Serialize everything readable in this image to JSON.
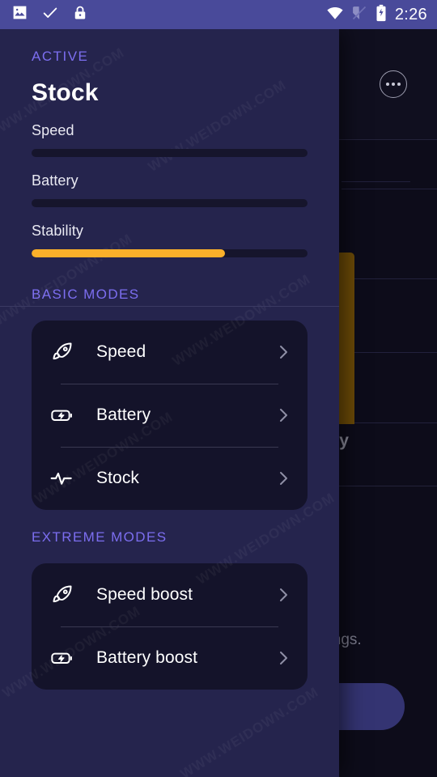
{
  "statusbar": {
    "time": "2:26",
    "left_icons": [
      "image-icon",
      "check-icon",
      "lock-icon"
    ],
    "right_icons": [
      "wifi-icon",
      "no-sim-icon",
      "battery-charging-icon"
    ],
    "background_color": "#494a9a"
  },
  "drawer": {
    "background_color": "#25244d",
    "watermark": "WWW.WEIDOWN.COM",
    "active": {
      "kicker": "ACTIVE",
      "title": "Stock",
      "accent_color": "#7c6ef0",
      "stats": [
        {
          "label": "Speed",
          "value": 0,
          "fill_color": "#fbb02a"
        },
        {
          "label": "Battery",
          "value": 0,
          "fill_color": "#fbb02a"
        },
        {
          "label": "Stability",
          "value": 70,
          "fill_color": "#fbb02a"
        }
      ]
    },
    "sections": [
      {
        "heading": "BASIC MODES",
        "items": [
          {
            "icon": "rocket-icon",
            "label": "Speed",
            "chevron": "chevron-right-icon"
          },
          {
            "icon": "battery-bolt-icon",
            "label": "Battery",
            "chevron": "chevron-right-icon"
          },
          {
            "icon": "pulse-icon",
            "label": "Stock",
            "chevron": "chevron-right-icon"
          }
        ]
      },
      {
        "heading": "EXTREME MODES",
        "items": [
          {
            "icon": "rocket-icon",
            "label": "Speed boost",
            "chevron": "chevron-right-icon"
          },
          {
            "icon": "battery-bolt-icon",
            "label": "Battery boost",
            "chevron": "chevron-right-icon"
          }
        ]
      }
    ]
  },
  "background_screen": {
    "more_button": "more-options-icon",
    "chart_label_partial": "lity",
    "body_text_partial": "ttings.",
    "cta_color": "#343472",
    "bar_color": "#6b4a07"
  },
  "chart_data": {
    "type": "bar",
    "categories": [
      "Stability"
    ],
    "values": [
      70
    ],
    "title": "",
    "xlabel": "",
    "ylabel": "",
    "ylim": [
      0,
      100
    ],
    "note": "Partially occluded bar chart behind the open navigation drawer; only one orange bar and the tail of its label are visible."
  }
}
